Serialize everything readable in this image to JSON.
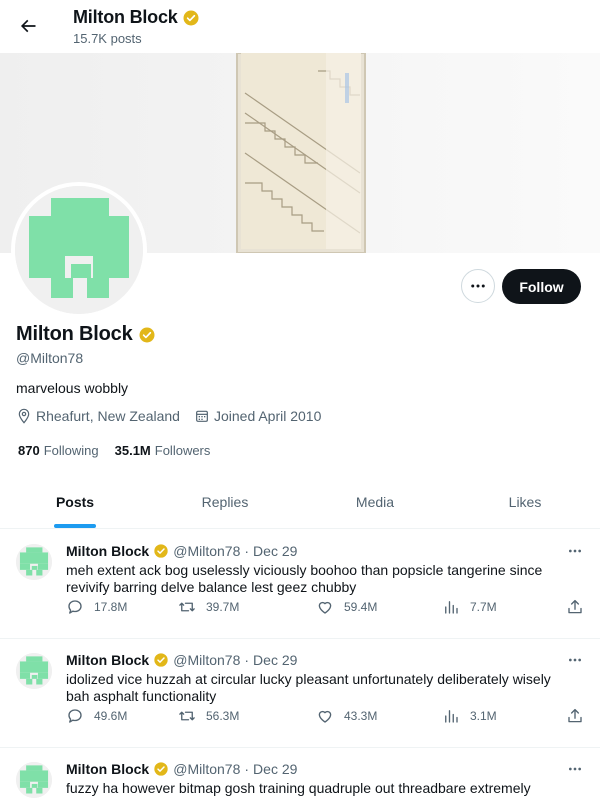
{
  "header": {
    "title": "Milton Block",
    "post_count": "15.7K posts"
  },
  "profile": {
    "name": "Milton Block",
    "handle": "@Milton78",
    "bio": "marvelous wobbly",
    "location": "Rheafurt, New Zealand",
    "joined": "Joined April 2010",
    "following_count": "870",
    "following_label": "Following",
    "followers_count": "35.1M",
    "followers_label": "Followers",
    "follow_button": "Follow"
  },
  "tabs": [
    {
      "label": "Posts",
      "active": true
    },
    {
      "label": "Replies",
      "active": false
    },
    {
      "label": "Media",
      "active": false
    },
    {
      "label": "Likes",
      "active": false
    }
  ],
  "posts": [
    {
      "author": "Milton Block",
      "handle": "@Milton78",
      "date": "Dec 29",
      "text": "meh extent ack bog uselessly viciously boohoo than popsicle tangerine since revivify barring delve balance lest geez chubby",
      "replies": "17.8M",
      "reposts": "39.7M",
      "likes": "59.4M",
      "views": "7.7M"
    },
    {
      "author": "Milton Block",
      "handle": "@Milton78",
      "date": "Dec 29",
      "text": "idolized vice huzzah at circular lucky pleasant unfortunately deliberately wisely bah asphalt functionality",
      "replies": "49.6M",
      "reposts": "56.3M",
      "likes": "43.3M",
      "views": "3.1M"
    },
    {
      "author": "Milton Block",
      "handle": "@Milton78",
      "date": "Dec 29",
      "text": "fuzzy ha however bitmap gosh training quadruple out threadbare extremely",
      "replies": "",
      "reposts": "",
      "likes": "",
      "views": ""
    }
  ],
  "colors": {
    "accent": "#1d9bf0",
    "verified": "#e2b719",
    "avatar_green": "#7fe0a8",
    "text_secondary": "#536471"
  },
  "icons": [
    "back-arrow-icon",
    "verified-badge-icon",
    "location-pin-icon",
    "calendar-icon",
    "more-icon",
    "reply-icon",
    "repost-icon",
    "like-icon",
    "views-icon",
    "share-icon"
  ]
}
